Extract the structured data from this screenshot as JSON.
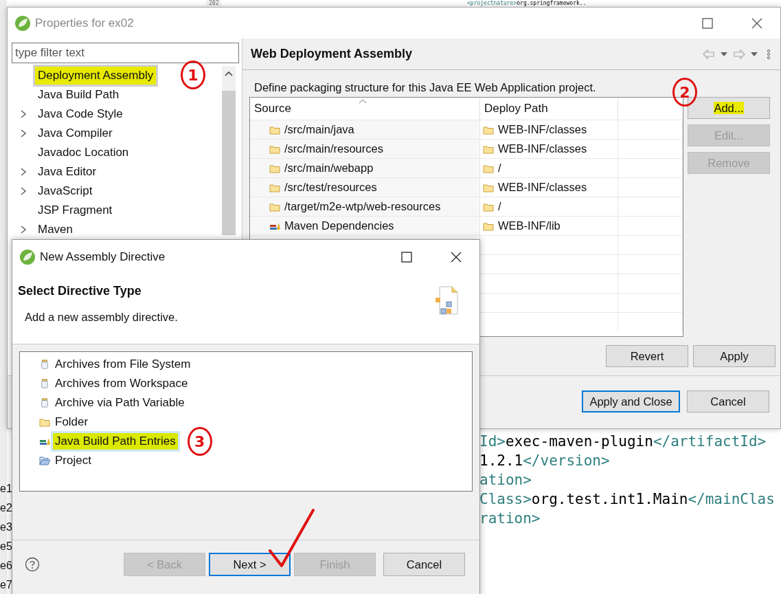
{
  "editor": {
    "line_number": "202",
    "top_line": [
      {
        "kind": "tag",
        "text": "<projectnature>"
      },
      {
        "kind": "text",
        "text": "org.springframework.."
      }
    ],
    "code_lines": [
      [
        {
          "kind": "tag",
          "text": "Id>"
        },
        {
          "kind": "text",
          "text": "exec-maven-plugin"
        },
        {
          "kind": "tag",
          "text": "</artifactId>"
        }
      ],
      [
        {
          "kind": "text",
          "text": "1.2.1"
        },
        {
          "kind": "tag",
          "text": "</version>"
        }
      ],
      [
        {
          "kind": "tag",
          "text": "ation>"
        }
      ],
      [
        {
          "kind": "tag",
          "text": "Class>"
        },
        {
          "kind": "text",
          "text": "org.test.int1.Main"
        },
        {
          "kind": "tag",
          "text": "</mainClas"
        }
      ],
      [
        {
          "kind": "tag",
          "text": "ration>"
        }
      ]
    ],
    "edge_fragments": [
      "e1",
      "e2",
      "e3",
      "e5",
      "e6",
      "e7"
    ]
  },
  "properties": {
    "title": "Properties for ex02",
    "filter": {
      "placeholder": "type filter text"
    },
    "tree": [
      {
        "label": "Deployment Assembly",
        "expandable": false,
        "selected": true,
        "highlighted": true
      },
      {
        "label": "Java Build Path",
        "expandable": false,
        "selected": false,
        "highlighted": false
      },
      {
        "label": "Java Code Style",
        "expandable": true,
        "selected": false,
        "highlighted": false
      },
      {
        "label": "Java Compiler",
        "expandable": true,
        "selected": false,
        "highlighted": false
      },
      {
        "label": "Javadoc Location",
        "expandable": false,
        "selected": false,
        "highlighted": false
      },
      {
        "label": "Java Editor",
        "expandable": true,
        "selected": false,
        "highlighted": false
      },
      {
        "label": "JavaScript",
        "expandable": true,
        "selected": false,
        "highlighted": false
      },
      {
        "label": "JSP Fragment",
        "expandable": false,
        "selected": false,
        "highlighted": false
      },
      {
        "label": "Maven",
        "expandable": true,
        "selected": false,
        "highlighted": false
      }
    ],
    "annotation_tree": "1",
    "page_title": "Web Deployment Assembly",
    "description": "Define packaging structure for this Java EE Web Application project.",
    "table": {
      "columns": [
        "Source",
        "Deploy Path"
      ],
      "rows": [
        {
          "source": "/src/main/java",
          "kind": "folder",
          "deploy_path": "WEB-INF/classes"
        },
        {
          "source": "/src/main/resources",
          "kind": "folder",
          "deploy_path": "WEB-INF/classes"
        },
        {
          "source": "/src/main/webapp",
          "kind": "folder",
          "deploy_path": "/"
        },
        {
          "source": "/src/test/resources",
          "kind": "folder",
          "deploy_path": "WEB-INF/classes"
        },
        {
          "source": "/target/m2e-wtp/web-resources",
          "kind": "folder",
          "deploy_path": "/"
        },
        {
          "source": "Maven Dependencies",
          "kind": "library",
          "deploy_path": "WEB-INF/lib"
        }
      ]
    },
    "annotation_add": "2",
    "side_buttons": [
      {
        "label": "Add...",
        "disabled": false,
        "highlighted": true
      },
      {
        "label": "Edit...",
        "disabled": true,
        "highlighted": false
      },
      {
        "label": "Remove",
        "disabled": true,
        "highlighted": false
      }
    ],
    "page_buttons": [
      "Revert",
      "Apply"
    ],
    "dialog_buttons": [
      {
        "label": "Apply and Close",
        "default": true
      },
      {
        "label": "Cancel",
        "default": false
      }
    ]
  },
  "wizard": {
    "title": "New Assembly Directive",
    "heading": "Select Directive Type",
    "description": "Add a new assembly directive.",
    "types": [
      {
        "label": "Archives from File System",
        "kind": "jar",
        "selected": false,
        "highlighted": false
      },
      {
        "label": "Archives from Workspace",
        "kind": "jar",
        "selected": false,
        "highlighted": false
      },
      {
        "label": "Archive via Path Variable",
        "kind": "jar",
        "selected": false,
        "highlighted": false
      },
      {
        "label": "Folder",
        "kind": "folder",
        "selected": false,
        "highlighted": false
      },
      {
        "label": "Java Build Path Entries",
        "kind": "library",
        "selected": true,
        "highlighted": true
      },
      {
        "label": "Project",
        "kind": "project",
        "selected": false,
        "highlighted": false
      }
    ],
    "annotation_list": "3",
    "buttons": [
      {
        "label": "< Back",
        "disabled": true,
        "default": false
      },
      {
        "label": "Next >",
        "disabled": false,
        "default": true
      },
      {
        "label": "Finish",
        "disabled": true,
        "default": false
      },
      {
        "label": "Cancel",
        "disabled": false,
        "default": false
      }
    ]
  }
}
